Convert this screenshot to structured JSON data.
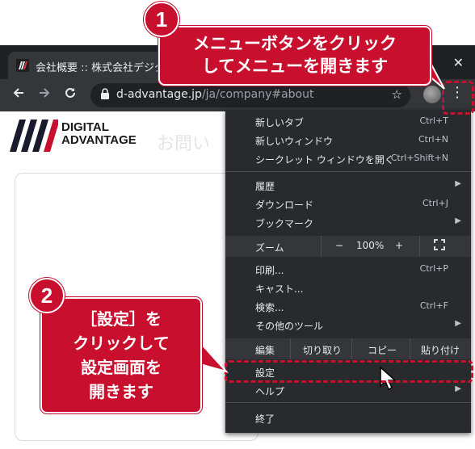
{
  "browser": {
    "tab_title": "会社概要 :: 株式会社デジタルア",
    "url_host": "d-advantage.jp",
    "url_path": "/ja/company#about",
    "window_close": "✕"
  },
  "page": {
    "logo_line1": "DIGITAL",
    "logo_line2": "ADVANTAGE",
    "ghost_text": "お問い"
  },
  "menu": {
    "group1": [
      {
        "label": "新しいタブ",
        "shortcut": "Ctrl+T"
      },
      {
        "label": "新しいウィンドウ",
        "shortcut": "Ctrl+N"
      },
      {
        "label": "シークレット ウィンドウを開く",
        "shortcut": "Ctrl+Shift+N"
      }
    ],
    "group2": [
      {
        "label": "履歴"
      },
      {
        "label": "ダウンロード",
        "shortcut": "Ctrl+J"
      },
      {
        "label": "ブックマーク"
      }
    ],
    "zoom": {
      "label": "ズーム",
      "minus": "−",
      "value": "100%",
      "plus": "+"
    },
    "group3": [
      {
        "label": "印刷...",
        "shortcut": "Ctrl+P"
      },
      {
        "label": "キャスト..."
      },
      {
        "label": "検索...",
        "shortcut": "Ctrl+F"
      },
      {
        "label": "その他のツール"
      }
    ],
    "edit": {
      "label": "編集",
      "cut": "切り取り",
      "copy": "コピー",
      "paste": "貼り付け"
    },
    "settings": "設定",
    "help": "ヘルプ",
    "exit": "終了"
  },
  "annotations": {
    "step1_number": "1",
    "step1_line1": "メニューボタンをクリック",
    "step1_line2": "してメニューを開きます",
    "step2_number": "2",
    "step2_line1": "［設定］を",
    "step2_line2": "クリックして",
    "step2_line3": "設定画面を",
    "step2_line4": "開きます"
  },
  "colors": {
    "accent_red": "#c8102e",
    "menu_bg": "#292a2d",
    "toolbar_bg": "#35363a"
  }
}
